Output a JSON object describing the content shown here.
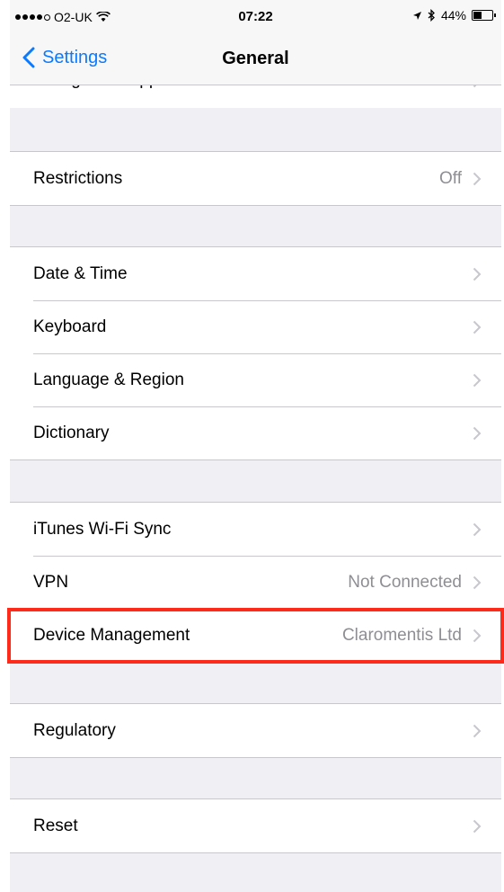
{
  "status_bar": {
    "carrier": "O2-UK",
    "time": "07:22",
    "battery_percent": "44%",
    "battery_level": 0.44
  },
  "nav": {
    "back_label": "Settings",
    "title": "General"
  },
  "partial_row": {
    "label": "Background App Refresh"
  },
  "groups": [
    {
      "rows": [
        {
          "label": "Restrictions",
          "value": "Off"
        }
      ]
    },
    {
      "rows": [
        {
          "label": "Date & Time",
          "value": ""
        },
        {
          "label": "Keyboard",
          "value": ""
        },
        {
          "label": "Language & Region",
          "value": ""
        },
        {
          "label": "Dictionary",
          "value": ""
        }
      ]
    },
    {
      "rows": [
        {
          "label": "iTunes Wi-Fi Sync",
          "value": ""
        },
        {
          "label": "VPN",
          "value": "Not Connected"
        },
        {
          "label": "Device Management",
          "value": "Claromentis Ltd"
        }
      ]
    },
    {
      "rows": [
        {
          "label": "Regulatory",
          "value": ""
        }
      ]
    },
    {
      "rows": [
        {
          "label": "Reset",
          "value": ""
        }
      ]
    }
  ],
  "colors": {
    "accent": "#0a7aff",
    "highlight": "#ff2a1a",
    "background": "#efeff4"
  },
  "icons": {
    "back": "chevron-left-icon",
    "disclosure": "chevron-right-icon",
    "wifi": "wifi-icon",
    "location": "location-arrow-icon",
    "bluetooth": "bluetooth-icon",
    "battery": "battery-icon"
  }
}
